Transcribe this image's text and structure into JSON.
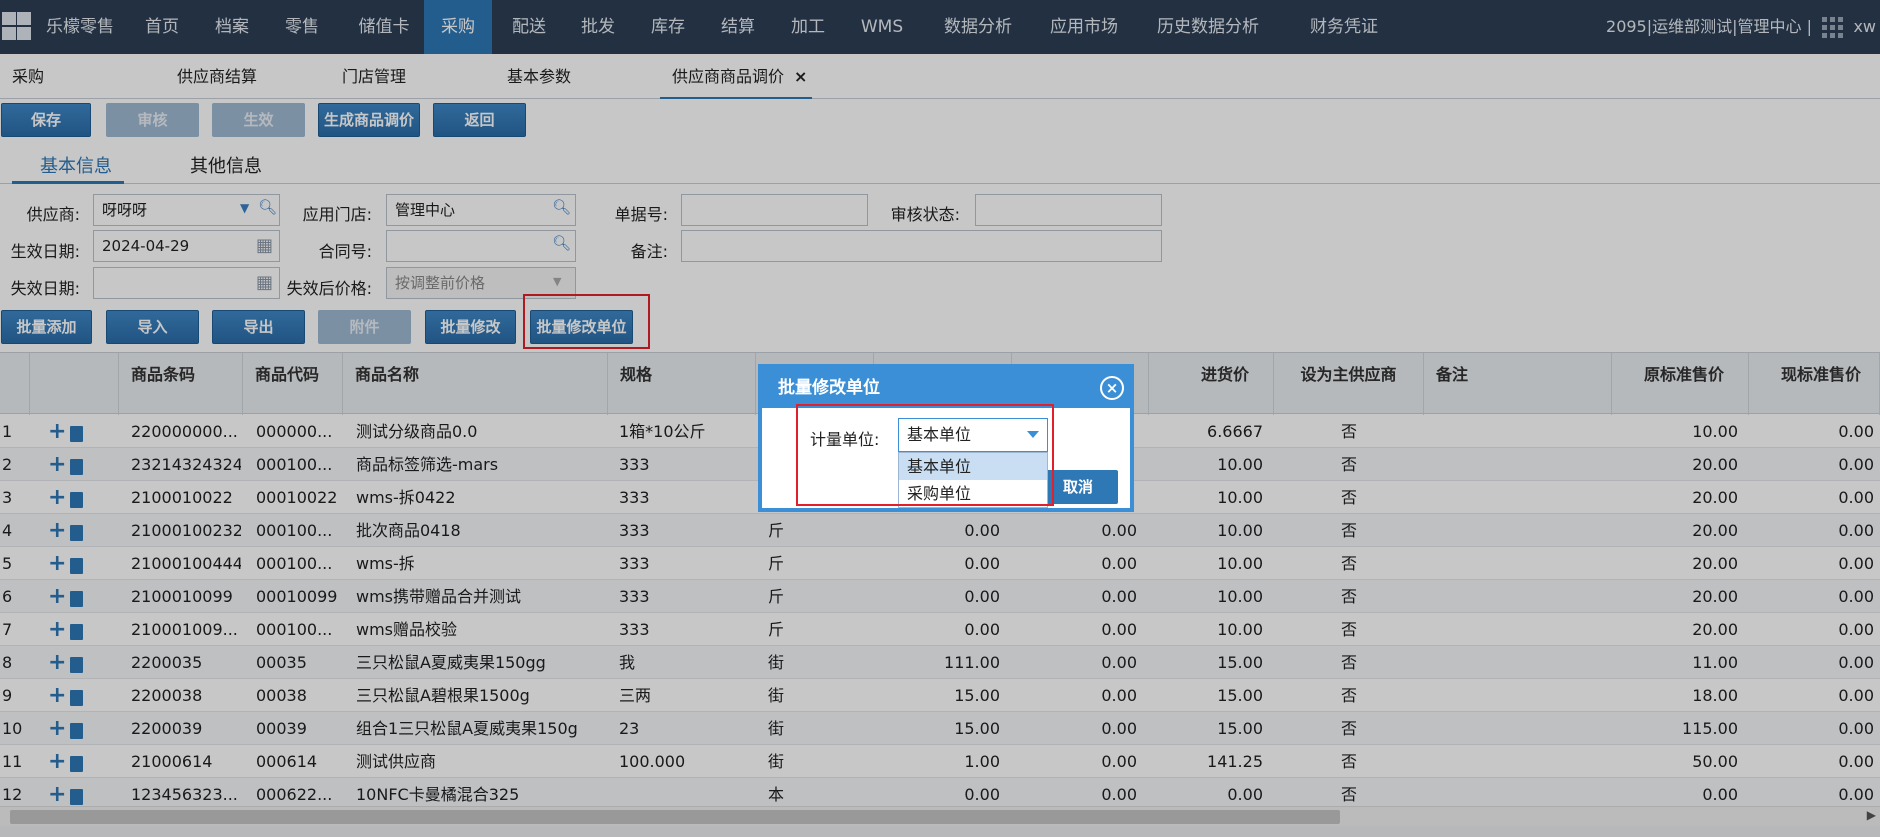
{
  "nav": {
    "items": [
      "乐檬零售",
      "首页",
      "档案",
      "零售",
      "储值卡",
      "采购",
      "配送",
      "批发",
      "库存",
      "结算",
      "加工",
      "WMS",
      "数据分析",
      "应用市场",
      "历史数据分析",
      "财务凭证"
    ],
    "active_index": 5,
    "context": "2095|运维部测试|管理中心 |",
    "user": "xw"
  },
  "page_tabs": {
    "items": [
      "采购",
      "供应商结算",
      "门店管理",
      "基本参数",
      "供应商商品调价"
    ],
    "close_glyph": "×"
  },
  "toolbar": {
    "save": "保存",
    "audit": "审核",
    "effective": "生效",
    "generate": "生成商品调价",
    "back": "返回"
  },
  "info_tabs": [
    "基本信息",
    "其他信息"
  ],
  "form": {
    "supplier_label": "供应商:",
    "supplier_value": "呀呀呀",
    "store_label": "应用门店:",
    "store_value": "管理中心",
    "doc_no_label": "单据号:",
    "doc_no_value": "",
    "audit_status_label": "审核状态:",
    "audit_status_value": "",
    "effective_date_label": "生效日期:",
    "effective_date_value": "2024-04-29",
    "contract_label": "合同号:",
    "contract_value": "",
    "remark_label": "备注:",
    "remark_value": "",
    "expire_date_label": "失效日期:",
    "expire_date_value": "",
    "after_price_label": "失效后价格:",
    "after_price_value": "按调整前价格"
  },
  "grid_toolbar": {
    "batch_add": "批量添加",
    "import": "导入",
    "export": "导出",
    "attachment": "附件",
    "batch_edit": "批量修改",
    "batch_edit_unit": "批量修改单位"
  },
  "table": {
    "headers": [
      "",
      "",
      "商品条码",
      "商品代码",
      "商品名称",
      "规格",
      "",
      "",
      "",
      "进货价",
      "设为主供应商",
      "备注",
      "原标准售价",
      "现标准售价"
    ],
    "rows": [
      {
        "no": "1",
        "barcode": "220000000...",
        "code": "000000...",
        "name": "测试分级商品0.0",
        "spec": "1箱*10公斤",
        "unit": "",
        "c1": "",
        "c2": "",
        "purchase": "6.6667",
        "main": "否",
        "remark": "",
        "orig": "10.00",
        "cur": "0.00"
      },
      {
        "no": "2",
        "barcode": "23214324324",
        "code": "000100...",
        "name": "商品标签筛选-mars",
        "spec": "333",
        "unit": "",
        "c1": "",
        "c2": "",
        "purchase": "10.00",
        "main": "否",
        "remark": "",
        "orig": "20.00",
        "cur": "0.00"
      },
      {
        "no": "3",
        "barcode": "2100010022",
        "code": "00010022",
        "name": "wms-拆0422",
        "spec": "333",
        "unit": "",
        "c1": "",
        "c2": "",
        "purchase": "10.00",
        "main": "否",
        "remark": "",
        "orig": "20.00",
        "cur": "0.00"
      },
      {
        "no": "4",
        "barcode": "21000100232",
        "code": "000100...",
        "name": "批次商品0418",
        "spec": "333",
        "unit": "斤",
        "c1": "0.00",
        "c2": "0.00",
        "purchase": "10.00",
        "main": "否",
        "remark": "",
        "orig": "20.00",
        "cur": "0.00"
      },
      {
        "no": "5",
        "barcode": "21000100444",
        "code": "000100...",
        "name": "wms-拆",
        "spec": "333",
        "unit": "斤",
        "c1": "0.00",
        "c2": "0.00",
        "purchase": "10.00",
        "main": "否",
        "remark": "",
        "orig": "20.00",
        "cur": "0.00"
      },
      {
        "no": "6",
        "barcode": "2100010099",
        "code": "00010099",
        "name": "wms携带赠品合并测试",
        "spec": "333",
        "unit": "斤",
        "c1": "0.00",
        "c2": "0.00",
        "purchase": "10.00",
        "main": "否",
        "remark": "",
        "orig": "20.00",
        "cur": "0.00"
      },
      {
        "no": "7",
        "barcode": "210001009...",
        "code": "000100...",
        "name": "wms赠品校验",
        "spec": "333",
        "unit": "斤",
        "c1": "0.00",
        "c2": "0.00",
        "purchase": "10.00",
        "main": "否",
        "remark": "",
        "orig": "20.00",
        "cur": "0.00"
      },
      {
        "no": "8",
        "barcode": "2200035",
        "code": "00035",
        "name": "三只松鼠A夏威夷果150gg",
        "spec": "我",
        "unit": "街",
        "c1": "111.00",
        "c2": "0.00",
        "purchase": "15.00",
        "main": "否",
        "remark": "",
        "orig": "11.00",
        "cur": "0.00"
      },
      {
        "no": "9",
        "barcode": "2200038",
        "code": "00038",
        "name": "三只松鼠A碧根果1500g",
        "spec": "三两",
        "unit": "街",
        "c1": "15.00",
        "c2": "0.00",
        "purchase": "15.00",
        "main": "否",
        "remark": "",
        "orig": "18.00",
        "cur": "0.00"
      },
      {
        "no": "10",
        "barcode": "2200039",
        "code": "00039",
        "name": "组合1三只松鼠A夏威夷果150g",
        "spec": "23",
        "unit": "街",
        "c1": "15.00",
        "c2": "0.00",
        "purchase": "15.00",
        "main": "否",
        "remark": "",
        "orig": "115.00",
        "cur": "0.00"
      },
      {
        "no": "11",
        "barcode": "21000614",
        "code": "000614",
        "name": "测试供应商",
        "spec": "100.000",
        "unit": "街",
        "c1": "1.00",
        "c2": "0.00",
        "purchase": "141.25",
        "main": "否",
        "remark": "",
        "orig": "50.00",
        "cur": "0.00"
      },
      {
        "no": "12",
        "barcode": "123456323...",
        "code": "000622...",
        "name": "10NFC卡曼橘混合325",
        "spec": "",
        "unit": "本",
        "c1": "0.00",
        "c2": "0.00",
        "purchase": "0.00",
        "main": "否",
        "remark": "",
        "orig": "0.00",
        "cur": "0.00"
      }
    ]
  },
  "dialog": {
    "title": "批量修改单位",
    "close_glyph": "×",
    "unit_label": "计量单位:",
    "unit_value": "基本单位",
    "cancel": "取消",
    "options": [
      "基本单位",
      "采购单位"
    ]
  },
  "colors": {
    "nav_bg": "#2c3e55",
    "accent": "#2d78b5",
    "highlight": "#e0202a"
  }
}
